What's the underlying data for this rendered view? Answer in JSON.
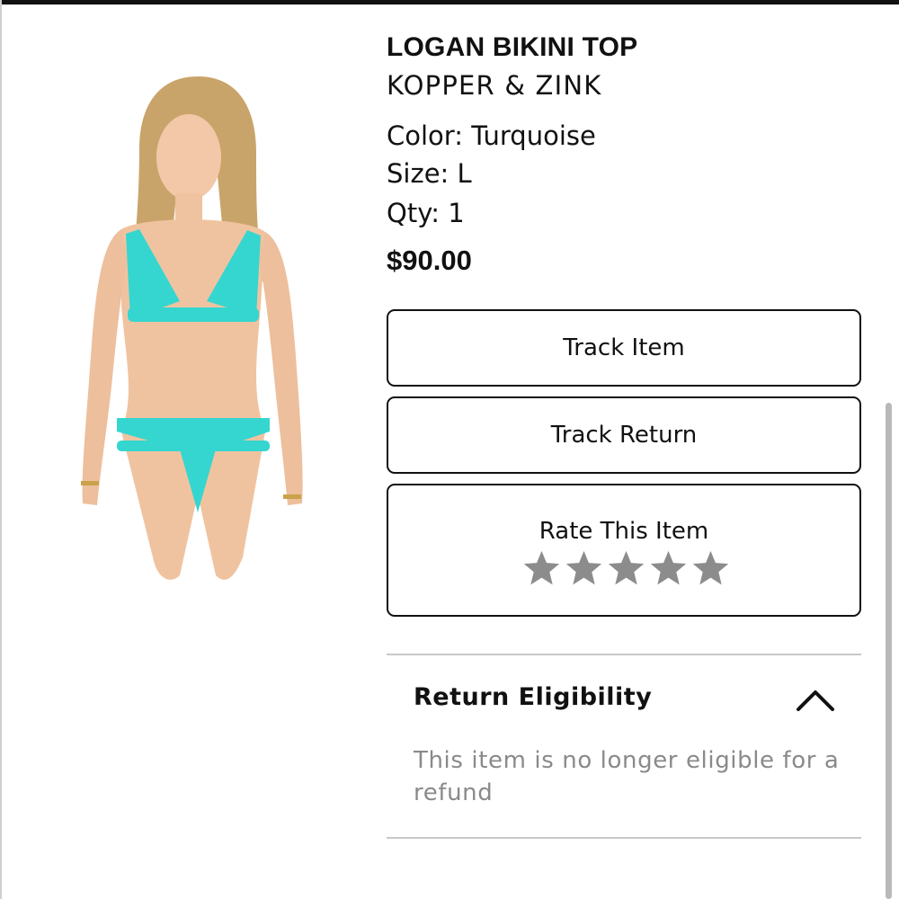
{
  "product": {
    "name": "LOGAN BIKINI TOP",
    "brand": "KOPPER & ZINK",
    "color": "Color: Turquoise",
    "size": "Size: L",
    "qty": "Qty: 1",
    "price": "$90.00",
    "swatch_color": "#35d6cf"
  },
  "actions": {
    "track_item": "Track Item",
    "track_return": "Track Return",
    "rate_label": "Rate This Item",
    "star_count": 5,
    "rating": 0,
    "star_color": "#8c8c8c"
  },
  "return_section": {
    "title": "Return Eligibility",
    "expanded": true,
    "message": "This item is no longer eligible for a refund"
  }
}
